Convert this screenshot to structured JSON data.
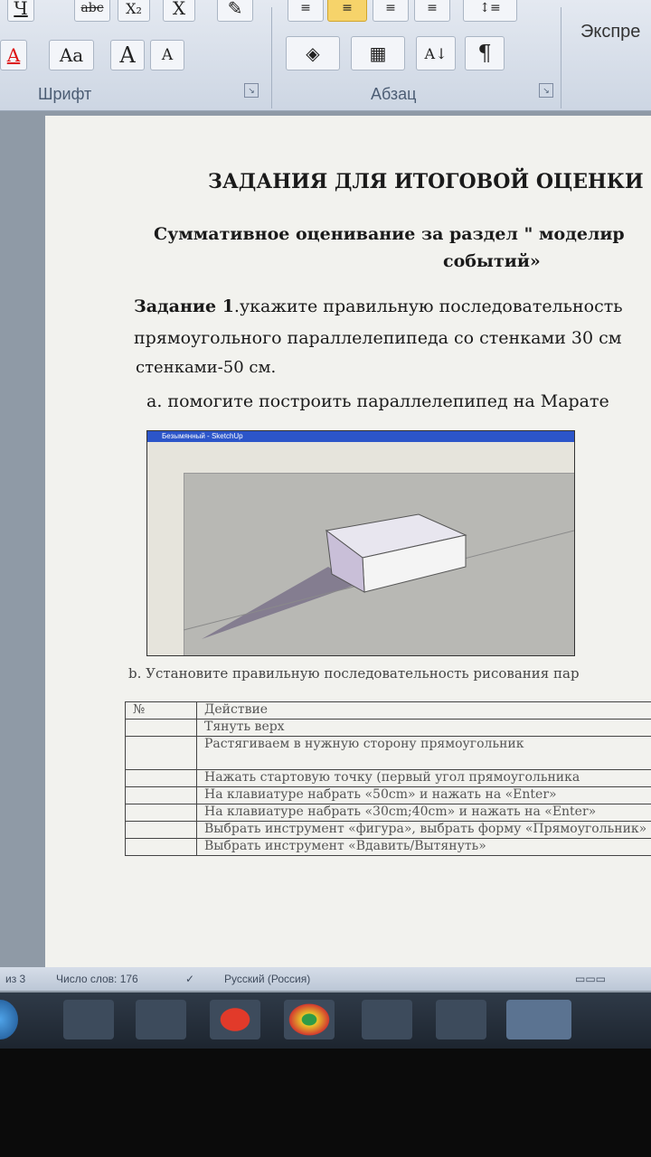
{
  "ribbon": {
    "font_group_label": "Шрифт",
    "paragraph_group_label": "Абзац",
    "styles_label": "Экспре",
    "buttons": {
      "underline": "Ч",
      "strike": "abc",
      "subscript": "X₂",
      "clear": "X",
      "font_color": "A",
      "change_case": "Aa",
      "grow_font": "A",
      "shrink_font": "A",
      "sort": "А↓",
      "pilcrow": "¶"
    }
  },
  "document": {
    "title": "ЗАДАНИЯ ДЛЯ ИТОГОВОЙ ОЦЕНКИ",
    "subtitle": "Суммативное оценивание  за раздел \" моделир",
    "subtitle_line2": "событий»",
    "task1_label": "Задание 1",
    "task1_text": ".укажите правильную последовательность",
    "task1_line2": "прямоугольного параллелепипеда со стенками 30 см",
    "task1_line3": "стенками-50 см.",
    "item_a": "a. помогите построить параллелепипед на Марате",
    "item_b": "b. Установите правильную последовательность рисования пар",
    "embedded_title": "Безымянный - SketchUp"
  },
  "table": {
    "headers": [
      "№",
      "Действие"
    ],
    "rows": [
      [
        "",
        "Тянуть верх"
      ],
      [
        "",
        "Растягиваем в нужную сторону прямоугольник"
      ],
      [
        "",
        "Нажать стартовую точку (первый угол прямоугольника"
      ],
      [
        "",
        "На клавиатуре набрать «50cm» и нажать на «Enter»"
      ],
      [
        "",
        "На клавиатуре набрать «30cm;40cm» и нажать на «Enter»"
      ],
      [
        "",
        "Выбрать инструмент «фигура», выбрать форму «Прямоугольник»"
      ],
      [
        "",
        "Выбрать инструмент «Вдавить/Вытянуть»"
      ]
    ]
  },
  "status": {
    "page": "из 3",
    "words": "Число слов: 176",
    "language": "Русский (Россия)"
  },
  "colors": {
    "ribbon_bg": "#dfe5ee",
    "highlight": "#f6d36a",
    "taskbar": "#1d252f"
  }
}
